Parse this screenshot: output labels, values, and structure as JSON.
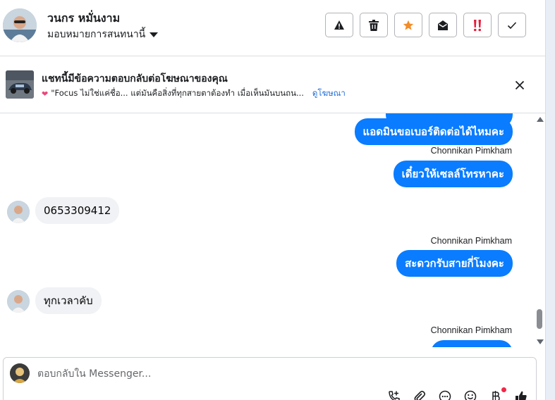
{
  "header": {
    "contact_name": "วนกร หมั่นงาม",
    "assign_label": "มอบหมายการสนทนานี้",
    "actions": [
      {
        "name": "report-spam",
        "icon": "warning-icon"
      },
      {
        "name": "delete",
        "icon": "trash-icon"
      },
      {
        "name": "star",
        "icon": "star-icon"
      },
      {
        "name": "mark-unread",
        "icon": "open-envelope-icon"
      },
      {
        "name": "follow-up",
        "icon": "double-exclamation-icon"
      },
      {
        "name": "mark-done",
        "icon": "check-icon"
      }
    ]
  },
  "ad_banner": {
    "title": "แชทนี้มีข้อความตอบกลับต่อโฆษณาของคุณ",
    "snippet": "\"Focus ไม่ใช่แค่ชื่อ... แต่มันคือสิ่งที่ทุกสายตาต้องทำ เมื่อเห็นมันบนถน...",
    "link_label": "ดูโฆษณา"
  },
  "conversation": {
    "messages": [
      {
        "direction": "out",
        "text": "แอดมินขอเบอร์ติดต่อได้ไหมคะ"
      },
      {
        "direction": "out",
        "sender": "Chonnikan Pimkham",
        "text": "เดี๋ยวให้เซลล์โทรหาคะ"
      },
      {
        "direction": "in",
        "text": "0653309412"
      },
      {
        "direction": "out",
        "sender": "Chonnikan Pimkham",
        "text": "สะดวกรับสายกี่โมงคะ"
      },
      {
        "direction": "in",
        "text": "ทุกเวลาคับ"
      },
      {
        "direction": "out",
        "sender": "Chonnikan Pimkham",
        "text": ""
      }
    ]
  },
  "composer": {
    "placeholder": "ตอบกลับใน Messenger...",
    "tools": [
      "phone-plus-icon",
      "paperclip-icon",
      "chat-dots-icon",
      "emoji-icon",
      "baht-icon",
      "thumbs-up-icon"
    ]
  },
  "colors": {
    "outgoing_bubble": "#0a7cff",
    "incoming_bubble": "#f0f2f5",
    "star": "#f28c28",
    "urgent": "#e41e3f",
    "link": "#216fdb"
  }
}
